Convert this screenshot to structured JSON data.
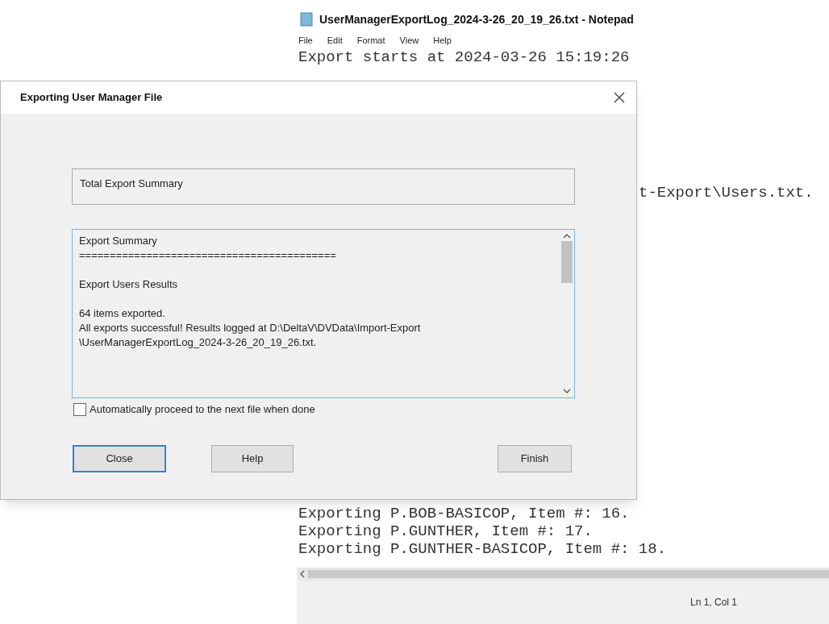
{
  "notepad": {
    "title": "UserManagerExportLog_2024-3-26_20_19_26.txt - Notepad",
    "menu": [
      "File",
      "Edit",
      "Format",
      "View",
      "Help"
    ],
    "lines_top": [
      "Export starts at 2024-03-26 15:19:26"
    ],
    "lines_right": [
      "t-Export\\Users.txt."
    ],
    "lines_bottom": [
      "Exporting P.BOB-BASICOP, Item #: 16.",
      "Exporting P.GUNTHER, Item #: 17.",
      "Exporting P.GUNTHER-BASICOP, Item #: 18."
    ],
    "status": "Ln 1, Col 1"
  },
  "dialog": {
    "title": "Exporting User Manager File",
    "total_summary": "Total Export Summary",
    "summary_paragraphs": [
      [
        "Export Summary",
        "=========================================="
      ],
      [
        "Export Users Results"
      ],
      [
        "64 items exported.",
        "All exports successful! Results logged at D:\\DeltaV\\DVData\\Import-Export",
        "\\UserManagerExportLog_2024-3-26_20_19_26.txt."
      ]
    ],
    "checkbox": {
      "label": "Automatically proceed to the next file when done",
      "checked": false
    },
    "buttons": [
      {
        "label": "Close",
        "default": true
      },
      {
        "label": "Help",
        "default": false
      },
      {
        "label": "Finish",
        "default": false
      }
    ]
  }
}
